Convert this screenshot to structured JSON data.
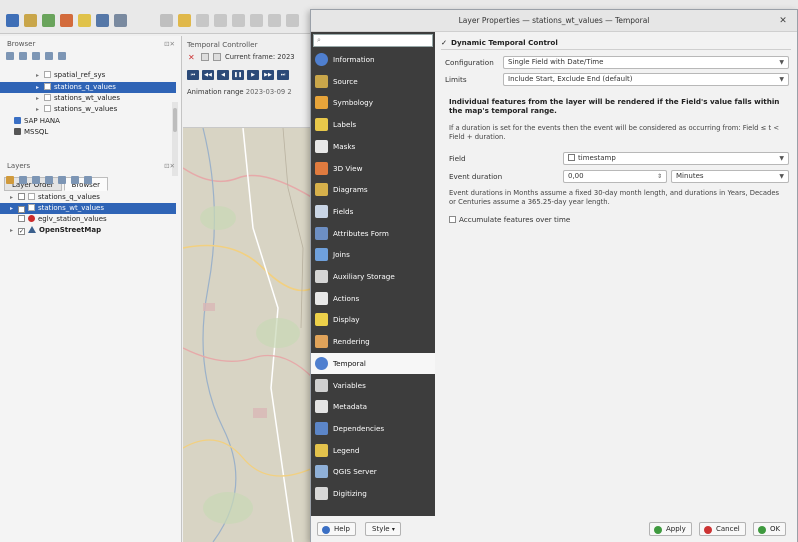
{
  "dialog": {
    "title": "Layer Properties — stations_wt_values — Temporal",
    "close_glyph": "✕",
    "search_placeholder": "",
    "sidebar": [
      {
        "label": "Information",
        "icon": "info-icon",
        "color": "#4f7fcf"
      },
      {
        "label": "Source",
        "icon": "source-icon",
        "color": "#c9a64a"
      },
      {
        "label": "Symbology",
        "icon": "symbology-icon",
        "color": "#e7a43a"
      },
      {
        "label": "Labels",
        "icon": "labels-icon",
        "color": "#e8c84a"
      },
      {
        "label": "Masks",
        "icon": "masks-icon",
        "color": "#e8e8e8"
      },
      {
        "label": "3D View",
        "icon": "cube-icon",
        "color": "#e07b3f"
      },
      {
        "label": "Diagrams",
        "icon": "diagrams-icon",
        "color": "#d6b04b"
      },
      {
        "label": "Fields",
        "icon": "fields-icon",
        "color": "#c9d5e6"
      },
      {
        "label": "Attributes Form",
        "icon": "form-icon",
        "color": "#6d8fc4"
      },
      {
        "label": "Joins",
        "icon": "joins-icon",
        "color": "#6fa0dc"
      },
      {
        "label": "Auxiliary Storage",
        "icon": "storage-icon",
        "color": "#d5d5d5"
      },
      {
        "label": "Actions",
        "icon": "actions-icon",
        "color": "#e8e8e8"
      },
      {
        "label": "Display",
        "icon": "display-icon",
        "color": "#ecd04a"
      },
      {
        "label": "Rendering",
        "icon": "rendering-icon",
        "color": "#e0a35a"
      },
      {
        "label": "Temporal",
        "icon": "clock-icon",
        "color": "#4f7fcf"
      },
      {
        "label": "Variables",
        "icon": "variables-icon",
        "color": "#d0d0d0"
      },
      {
        "label": "Metadata",
        "icon": "metadata-icon",
        "color": "#e4e4e4"
      },
      {
        "label": "Dependencies",
        "icon": "dependencies-icon",
        "color": "#5c86c9"
      },
      {
        "label": "Legend",
        "icon": "legend-icon",
        "color": "#e3c24c"
      },
      {
        "label": "QGIS Server",
        "icon": "server-icon",
        "color": "#8fb0d8"
      },
      {
        "label": "Digitizing",
        "icon": "digitizing-icon",
        "color": "#d8d8d8"
      }
    ],
    "selected_section": "Temporal",
    "content": {
      "section_title": "Dynamic Temporal Control",
      "configuration_label": "Configuration",
      "configuration_value": "Single Field with Date/Time",
      "limits_label": "Limits",
      "limits_value": "Include Start, Exclude End (default)",
      "bold_note": "Individual features from the layer will be rendered if the Field's value falls within the map's temporal range.",
      "duration_note": "If a duration is set for the events then the event will be considered as occurring from: Field ≤ t < Field + duration.",
      "field_label": "Field",
      "field_value": "timestamp",
      "event_duration_label": "Event duration",
      "event_duration_value": "0,00",
      "duration_unit": "Minutes",
      "months_note": "Event durations in Months assume a fixed 30-day month length, and durations in Years, Decades or Centuries assume a 365.25-day year length.",
      "accumulate_label": "Accumulate features over time"
    },
    "footer": {
      "help": "Help",
      "style": "Style",
      "apply": "Apply",
      "cancel": "Cancel",
      "ok": "OK"
    }
  },
  "qgis": {
    "browser_title": "Browser",
    "float_glyph": "⊡✕",
    "browser_items": [
      {
        "label": "spatial_ref_sys",
        "selected": false
      },
      {
        "label": "stations_q_values",
        "selected": true
      },
      {
        "label": "stations_wt_values",
        "selected": false
      },
      {
        "label": "stations_w_values",
        "selected": false
      },
      {
        "label": "SAP HANA",
        "selected": false
      },
      {
        "label": "MSSQL",
        "selected": false
      }
    ],
    "panel_tabs": [
      "Layer Order",
      "Browser"
    ],
    "layers_title": "Layers",
    "layers": [
      {
        "label": "stations_q_values",
        "selected": false
      },
      {
        "label": "stations_wt_values",
        "selected": true
      },
      {
        "label": "eglv_station_values",
        "selected": false
      },
      {
        "label": "OpenStreetMap",
        "selected": false
      }
    ],
    "temporal_title": "Temporal Controller",
    "current_frame": "Current frame: 2023",
    "animation_range_label": "Animation range",
    "animation_range_value": "2023-03-09 2"
  },
  "colors": {
    "sidebar_bg": "#3d3d3d",
    "selection_blue": "#2f64b6",
    "apply_green": "#3f9a3f",
    "cancel_red": "#cc3333"
  }
}
